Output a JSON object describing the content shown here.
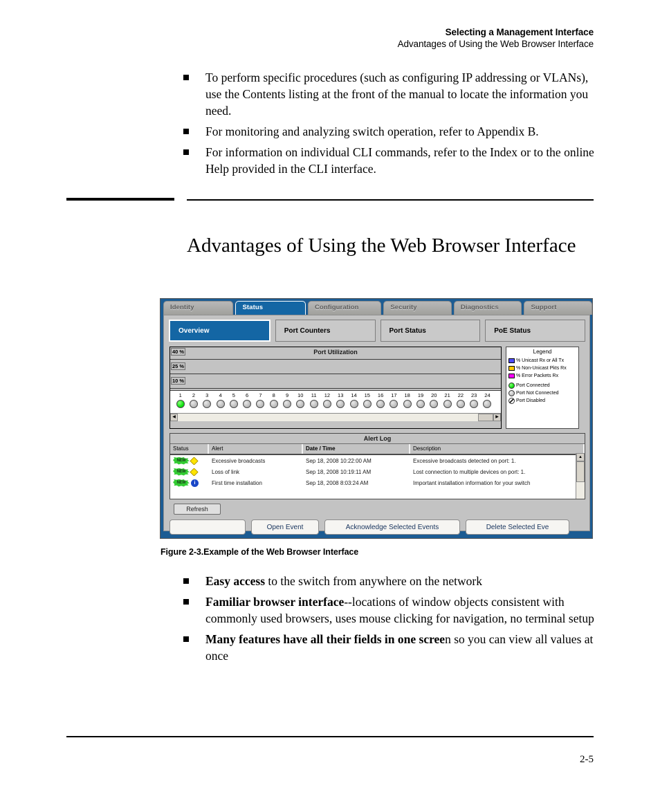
{
  "page_header": {
    "line1": "Selecting a Management Interface",
    "line2": "Advantages of Using the Web Browser Interface"
  },
  "intro_bullets": [
    "To perform specific procedures (such as configuring IP addressing or VLANs), use the Contents listing at the front of the manual to locate the information you need.",
    "For monitoring and analyzing switch operation, refer to Appendix B.",
    "For information on individual CLI commands, refer to the Index or to the online Help provided in the CLI interface."
  ],
  "section_title": "Advantages of Using the Web Browser Interface",
  "figure": {
    "caption": "Figure 2-3.Example of the Web Browser Interface",
    "main_tabs": [
      {
        "label": "Identity",
        "active": false
      },
      {
        "label": "Status",
        "active": true
      },
      {
        "label": "Configuration",
        "active": false
      },
      {
        "label": "Security",
        "active": false
      },
      {
        "label": "Diagnostics",
        "active": false
      },
      {
        "label": "Support",
        "active": false
      }
    ],
    "sub_tabs": [
      {
        "label": "Overview",
        "active": true
      },
      {
        "label": "Port Counters",
        "active": false
      },
      {
        "label": "Port Status",
        "active": false
      },
      {
        "label": "PoE Status",
        "active": false
      }
    ],
    "port_utilization": {
      "title": "Port Utilization",
      "y_labels": [
        "40 %",
        "25 %",
        "10 %"
      ]
    },
    "legend": {
      "title": "Legend",
      "items": [
        {
          "label": "% Unicast Rx or All Tx",
          "color": "#4d4dff",
          "shape": "swatch"
        },
        {
          "label": "% Non-Unicast Pkts Rx",
          "color": "#ffcc00",
          "shape": "swatch"
        },
        {
          "label": "% Error Packets Rx",
          "color": "#ff00ff",
          "shape": "swatch"
        },
        {
          "label": "Port Connected",
          "color": "#11e211",
          "shape": "dot"
        },
        {
          "label": "Port Not Connected",
          "color": "#c4c4c4",
          "shape": "dot"
        },
        {
          "label": "Port Disabled",
          "color": "#ffffff",
          "shape": "dot-hatched"
        }
      ]
    },
    "alert_log": {
      "title": "Alert Log",
      "columns": [
        "Status",
        "Alert",
        "Date / Time",
        "Description"
      ],
      "rows": [
        {
          "status_badge": "NEW",
          "severity": "warning",
          "alert": "Excessive broadcasts",
          "datetime": "Sep 18, 2008 10:22:00 AM",
          "description": "Excessive broadcasts detected on port: 1."
        },
        {
          "status_badge": "NEW",
          "severity": "warning",
          "alert": "Loss of link",
          "datetime": "Sep 18, 2008 10:19:11 AM",
          "description": "Lost connection to multiple devices on port: 1."
        },
        {
          "status_badge": "NEW",
          "severity": "info",
          "alert": "First time installation",
          "datetime": "Sep 18, 2008 8:03:24 AM",
          "description": "Important installation information for your switch"
        }
      ]
    },
    "buttons": {
      "refresh": "Refresh",
      "blank": "",
      "open_event": "Open Event",
      "acknowledge": "Acknowledge Selected Events",
      "delete": "Delete Selected Eve"
    }
  },
  "advantage_bullets": [
    {
      "bold": "Easy access",
      "rest": " to the switch from anywhere on the network"
    },
    {
      "bold": "Familiar browser interface",
      "rest": "--locations of window objects consistent with commonly used browsers, uses mouse clicking for navigation, no terminal setup"
    },
    {
      "bold": "Many features have all their fields in one scree",
      "rest": "n so you can view all values at once"
    }
  ],
  "footer": {
    "page_number": "2-5"
  },
  "chart_data": {
    "type": "bar",
    "title": "Port Utilization",
    "xlabel": "",
    "ylabel": "",
    "ylim": [
      0,
      40
    ],
    "yticks": [
      10,
      25,
      40
    ],
    "ytick_labels": [
      "10 %",
      "25 %",
      "40 %"
    ],
    "grid": true,
    "legend_position": "right",
    "categories": [
      "1",
      "2",
      "3",
      "4",
      "5",
      "6",
      "7",
      "8",
      "9",
      "10",
      "11",
      "12",
      "13",
      "14",
      "15",
      "16",
      "17",
      "18",
      "19",
      "20",
      "21",
      "22",
      "23",
      "24"
    ],
    "series": [
      {
        "name": "% Unicast Rx or All Tx",
        "color": "#4d4dff",
        "values": [
          0,
          0,
          0,
          0,
          0,
          0,
          0,
          0,
          0,
          0,
          0,
          0,
          0,
          0,
          0,
          0,
          0,
          0,
          0,
          0,
          0,
          0,
          0,
          0
        ]
      },
      {
        "name": "% Non-Unicast Pkts Rx",
        "color": "#ffcc00",
        "values": [
          0,
          0,
          0,
          0,
          0,
          0,
          0,
          0,
          0,
          0,
          0,
          0,
          0,
          0,
          0,
          0,
          0,
          0,
          0,
          0,
          0,
          0,
          0,
          0
        ]
      },
      {
        "name": "% Error Packets Rx",
        "color": "#ff00ff",
        "values": [
          0,
          0,
          0,
          0,
          0,
          0,
          0,
          0,
          0,
          0,
          0,
          0,
          0,
          0,
          0,
          0,
          0,
          0,
          0,
          0,
          0,
          0,
          0,
          0
        ]
      }
    ],
    "port_status": [
      "connected",
      "not-connected",
      "not-connected",
      "not-connected",
      "not-connected",
      "not-connected",
      "not-connected",
      "not-connected",
      "not-connected",
      "not-connected",
      "not-connected",
      "not-connected",
      "not-connected",
      "not-connected",
      "not-connected",
      "not-connected",
      "not-connected",
      "not-connected",
      "not-connected",
      "not-connected",
      "not-connected",
      "not-connected",
      "not-connected",
      "not-connected"
    ]
  }
}
